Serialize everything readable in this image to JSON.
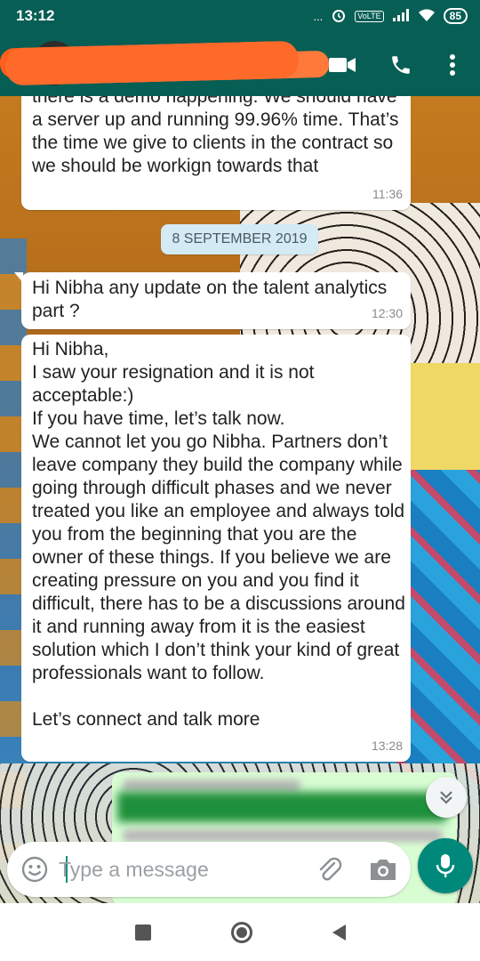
{
  "status_bar": {
    "time": "13:12",
    "dots": "...",
    "volte": "VoLTE",
    "battery": "85"
  },
  "app_bar": {
    "contact_name": "",
    "icons": [
      "back-arrow-icon",
      "video-call-icon",
      "phone-icon",
      "more-vert-icon"
    ]
  },
  "messages": [
    {
      "direction": "incoming",
      "text": "there is a demo happening. We should have a server up and running 99.96% time. That’s the time we give to clients in the contract so we should be workign towards that",
      "time": "11:36"
    },
    {
      "direction": "incoming",
      "text": "Hi Nibha any update on the talent analytics part ?",
      "time": "12:30"
    },
    {
      "direction": "incoming",
      "text": "Hi Nibha,\nI saw your resignation and it is not acceptable:)\nIf you have time, let’s talk now.\nWe cannot let you go Nibha. Partners don’t leave company they build the company while going through difficult phases and we never treated you like an employee and always told you from the beginning that you are the owner of these things. If you believe we are creating pressure on you and you find it difficult, there has to be a discussions around it and running away from it is the easiest solution which I don’t think your kind of great professionals want to follow.\n\nLet’s connect and talk more",
      "time": "13:28"
    }
  ],
  "date_chip": "8 SEPTEMBER 2019",
  "composer": {
    "placeholder": "Type a message"
  },
  "colors": {
    "header": "#075e54",
    "accent": "#00897b",
    "outgoing_bubble": "#d9fdd3",
    "date_chip": "#d4eaf4"
  }
}
